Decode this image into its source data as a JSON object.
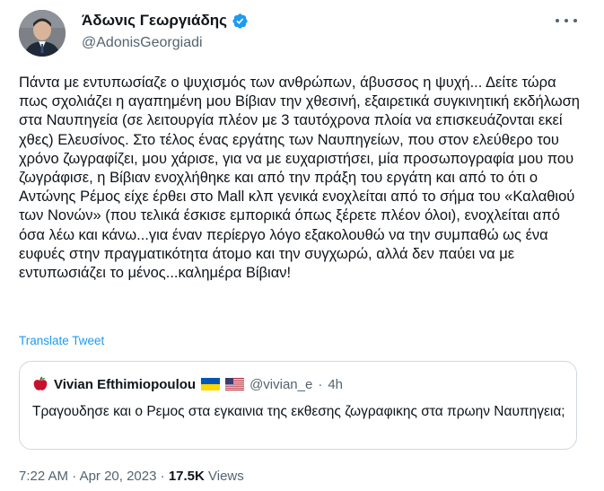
{
  "author": {
    "display_name": "Άδωνις Γεωργιάδης",
    "handle": "@AdonisGeorgiadi",
    "verified": true,
    "avatar_icon": "profile-photo"
  },
  "tweet": {
    "text": "Πάντα με εντυπωσίαζε ο ψυχισμός των ανθρώπων, άβυσσος η ψυχή... Δείτε τώρα πως σχολιάζει η αγαπημένη μου Βίβιαν την χθεσινή, εξαιρετικά συγκινητική εκδήλωση στα Ναυπηγεία (σε λειτουργία πλέον με 3 ταυτόχρονα πλοία να επισκευάζονται εκεί χθες) Ελευσίνος. Στο τέλος ένας εργάτης των Ναυπηγείων, που στον ελεύθερο του χρόνο ζωγραφίζει, μου χάρισε, για να με ευχαριστήσει, μία προσωπογραφία μου που ζωγράφισε, η Βίβιαν ενοχλήθηκε και από την πράξη του εργάτη και από το ότι ο Αντώνης Ρέμος είχε έρθει στο Mall κλπ γενικά ενοχλείται από το σήμα του «Καλαθιού των Νονών» (που τελικά έσκισε εμπορικά όπως ξέρετε πλέον όλοι), ενοχλείται από όσα λέω και κάνω...για έναν περίεργο λόγο εξακολουθώ να την συμπαθώ ως ένα ευφυές στην πραγματικότητα άτομο και την συγχωρώ, αλλά δεν παύει να με εντυπωσιάζει το μένος...καλημέρα Βίβιαν!",
    "translate_label": "Translate Tweet"
  },
  "quoted_tweet": {
    "avatar_icon": "red-apple-icon",
    "display_name": "Vivian Efthimiopoulou",
    "flags": [
      "ukraine-flag-icon",
      "usa-flag-icon"
    ],
    "handle": "@vivian_e",
    "separator": "·",
    "time": "4h",
    "text": "Τραγουδησε και ο Ρεμος στα εγκαινια της εκθεσης ζωγραφικης στα πρωην Ναυπηγεια;"
  },
  "meta": {
    "time": "7:22 AM",
    "separator": "·",
    "date": "Apr 20, 2023",
    "views_count": "17.5K",
    "views_label": "Views"
  },
  "colors": {
    "link": "#1d9bf0",
    "secondary_text": "#536471",
    "primary_text": "#0f1419",
    "border": "#cfd9de"
  }
}
